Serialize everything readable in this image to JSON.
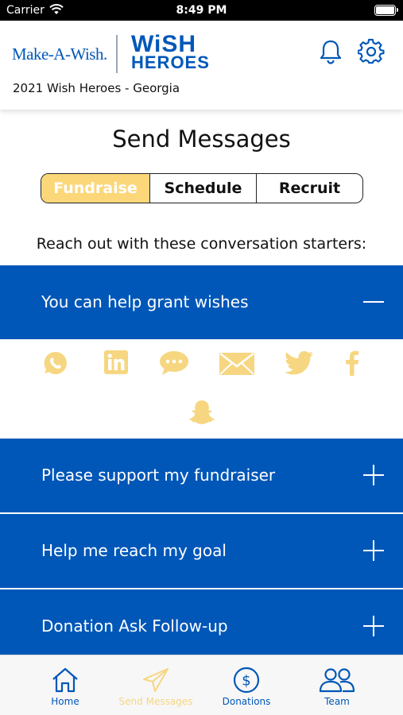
{
  "status_bar": {
    "carrier": "Carrier",
    "time": "8:49 PM"
  },
  "header": {
    "logo_make_a_wish": "Make-A-Wish.",
    "logo_wish": "WiSH",
    "logo_heroes": "HEROES",
    "title": "2021 Wish Heroes - Georgia",
    "icons": [
      "bell-icon",
      "gear-icon"
    ]
  },
  "page": {
    "title": "Send Messages",
    "intro": "Reach out with these conversation starters:"
  },
  "segments": {
    "items": [
      "Fundraise",
      "Schedule",
      "Recruit"
    ],
    "selected": "Fundraise"
  },
  "accordion": {
    "items": [
      {
        "label": "You can help grant wishes",
        "expanded": true
      },
      {
        "label": "Please support my fundraiser",
        "expanded": false
      },
      {
        "label": "Help me reach my goal",
        "expanded": false
      },
      {
        "label": "Donation Ask Follow-up",
        "expanded": false
      }
    ]
  },
  "share_icons": [
    "whatsapp-icon",
    "linkedin-icon",
    "sms-icon",
    "email-icon",
    "twitter-icon",
    "facebook-icon",
    "snapchat-icon"
  ],
  "tabs": {
    "items": [
      {
        "label": "Home",
        "icon": "home-icon"
      },
      {
        "label": "Send Messages",
        "icon": "paper-plane-icon"
      },
      {
        "label": "Donations",
        "icon": "dollar-circle-icon"
      },
      {
        "label": "Team",
        "icon": "team-icon"
      }
    ],
    "selected": "Send Messages"
  },
  "colors": {
    "brand_blue": "#0057b8",
    "accent_yellow": "#fbd77a",
    "icon_yellow": "#f6d680",
    "status_bar": "#000000"
  }
}
